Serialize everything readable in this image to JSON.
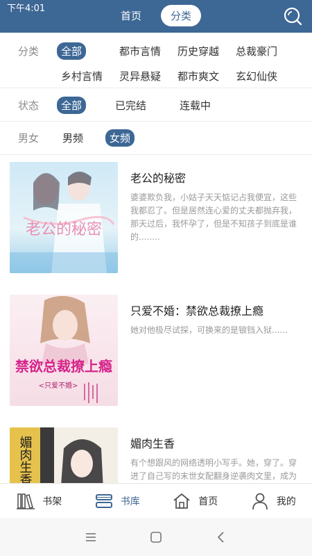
{
  "status_bar": {
    "time": "下午4:01"
  },
  "header": {
    "tabs": [
      {
        "label": "首页",
        "active": false
      },
      {
        "label": "分类",
        "active": true
      }
    ],
    "search_icon": "search-icon",
    "color": "#3d6795"
  },
  "filters": {
    "category": {
      "label": "分类",
      "options": [
        "全部",
        "都市言情",
        "历史穿越",
        "总裁豪门",
        "乡村言情",
        "灵异悬疑",
        "都市爽文",
        "玄幻仙侠"
      ],
      "selected": "全部"
    },
    "status": {
      "label": "状态",
      "options": [
        "全部",
        "已完结",
        "连载中"
      ],
      "selected": "全部"
    },
    "gender": {
      "label": "男女",
      "options": [
        "男频",
        "女频"
      ],
      "selected": "女频"
    }
  },
  "books": [
    {
      "title": "老公的秘密",
      "desc": "婆婆欺负我，小姑子天天惦记占我便宜，这些我都忍了。但是居然连心爱的丈夫都抛弃我，那天过后，我怀孕了，但是不知孩子到底是谁的........",
      "cover_text": "老公的秘密"
    },
    {
      "title": "只爱不婚：禁欲总裁撩上瘾",
      "desc": "她对他极尽试探，可换来的是锒铛入狱......",
      "cover_text": "禁欲总裁撩上瘾",
      "cover_sub": "<只爱不婚>"
    },
    {
      "title": "媚肉生香",
      "desc": "有个想跟风的网络透明小写手。她，穿了。穿进了自己写的末世女配翻身逆袭肉文里，成为了原女主，原女主明险狠",
      "cover_text": "媚肉生香"
    }
  ],
  "bottom_nav": [
    {
      "label": "书架",
      "icon": "bookshelf-icon",
      "active": false
    },
    {
      "label": "书库",
      "icon": "library-icon",
      "active": true
    },
    {
      "label": "首页",
      "icon": "home-icon",
      "active": false
    },
    {
      "label": "我的",
      "icon": "user-icon",
      "active": false
    }
  ],
  "system_nav": [
    "menu-icon",
    "home-square-icon",
    "back-icon"
  ]
}
